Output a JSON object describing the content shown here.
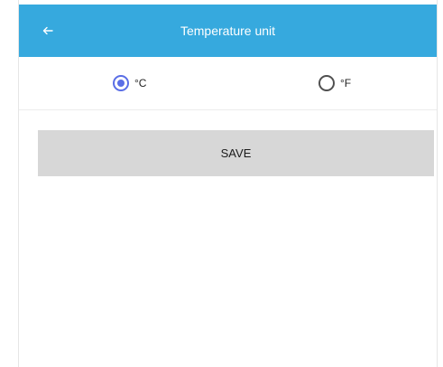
{
  "app_bar": {
    "title": "Temperature unit",
    "back_icon": "arrow-left-icon",
    "background_color": "#36a9de"
  },
  "unit_options": [
    {
      "label": "°C",
      "selected": true
    },
    {
      "label": "°F",
      "selected": false
    }
  ],
  "save_button": {
    "label": "SAVE"
  },
  "colors": {
    "radio_selected": "#5a6ee6",
    "button_background": "#d7d7d7"
  }
}
